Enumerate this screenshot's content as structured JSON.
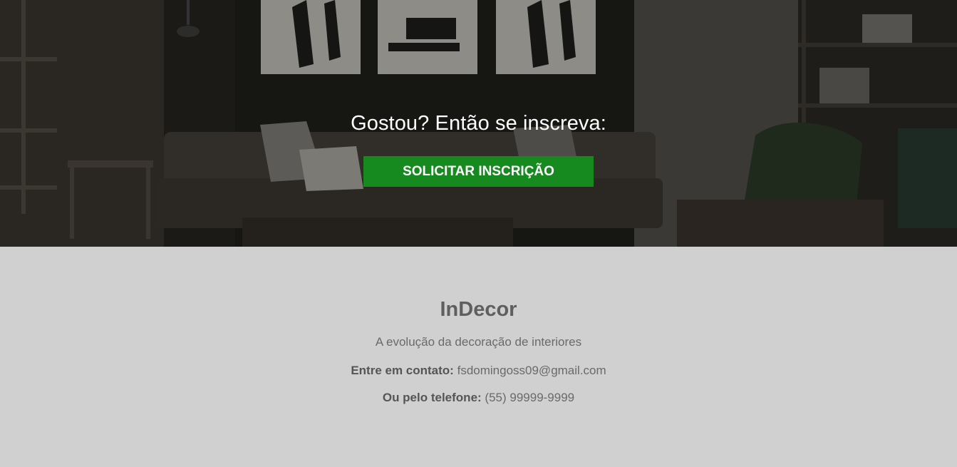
{
  "hero": {
    "title": "Gostou? Então se inscreva:",
    "button_label": "SOLICITAR INSCRIÇÃO",
    "button_color": "#178a1f"
  },
  "footer": {
    "brand": "InDecor",
    "tagline": "A evolução da decoração de interiores",
    "email_label": "Entre em contato:",
    "email_value": "fsdomingoss09@gmail.com",
    "phone_label": "Ou pelo telefone:",
    "phone_value": "(55) 99999-9999",
    "background_color": "#d0d0d0"
  }
}
